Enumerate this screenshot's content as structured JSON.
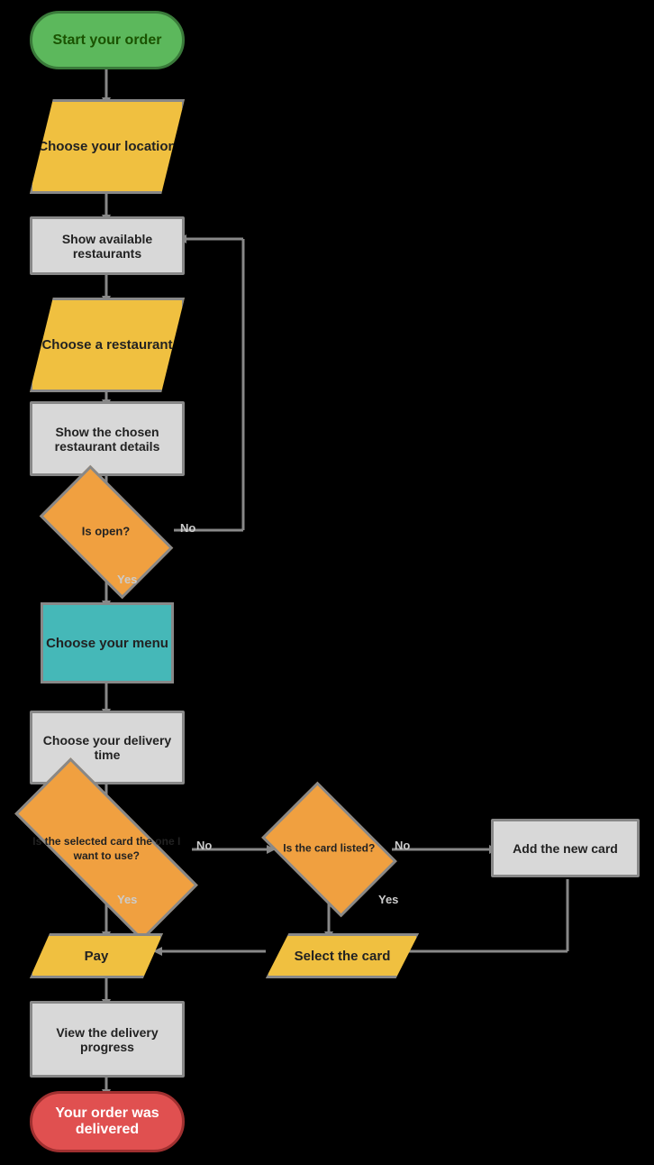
{
  "nodes": {
    "start": "Start your order",
    "choose_location": "Choose your location",
    "show_restaurants": "Show available restaurants",
    "choose_restaurant": "Choose a restaurant",
    "show_restaurant_details": "Show the chosen restaurant details",
    "is_open": "Is open?",
    "choose_menu": "Choose your menu",
    "choose_delivery_time": "Choose your delivery time",
    "is_selected_card": "Is the selected card the one I want to use?",
    "is_card_listed": "Is the card listed?",
    "add_new_card": "Add the new card",
    "pay": "Pay",
    "select_card": "Select the card",
    "view_delivery": "View the delivery progress",
    "delivered": "Your order was delivered"
  },
  "labels": {
    "yes1": "Yes",
    "no1": "No",
    "yes2": "Yes",
    "no2": "No",
    "yes3": "Yes",
    "no3": "No"
  }
}
